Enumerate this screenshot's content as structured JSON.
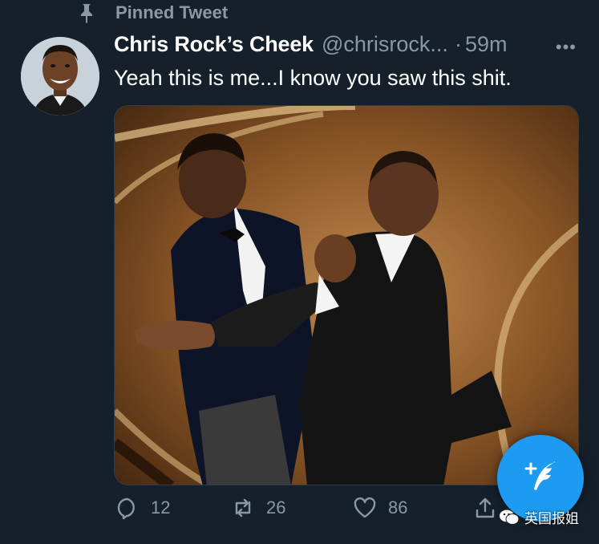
{
  "pinned": {
    "label": "Pinned Tweet",
    "icon": "pin-icon"
  },
  "tweet": {
    "display_name": "Chris Rock’s Cheek",
    "handle": "@chrisrock...",
    "separator": "·",
    "timestamp": "59m",
    "more_icon": "more-dots-icon",
    "text": "Yeah this is me...I know you saw this shit."
  },
  "actions": {
    "reply_count": "12",
    "retweet_count": "26",
    "like_count": "86"
  },
  "fab": {
    "icon": "compose-tweet-icon"
  },
  "watermark": {
    "text": "英国报姐",
    "icon": "wechat-icon"
  },
  "colors": {
    "background": "#15202b",
    "secondary_text": "#8b98a5",
    "accent": "#1d9bf0"
  }
}
